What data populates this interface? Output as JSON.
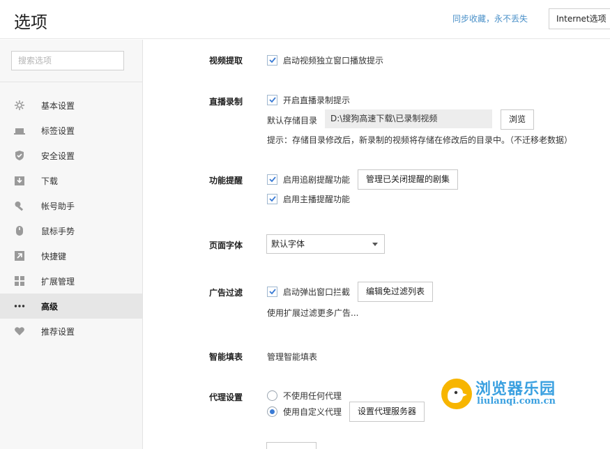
{
  "header": {
    "title": "选项",
    "sync_text": "同步收藏，永不丢失",
    "ie_button": "Internet选项"
  },
  "sidebar": {
    "search_placeholder": "搜索选项",
    "items": [
      {
        "label": "基本设置",
        "icon": "gear-icon"
      },
      {
        "label": "标签设置",
        "icon": "tab-icon"
      },
      {
        "label": "安全设置",
        "icon": "shield-icon"
      },
      {
        "label": "下载",
        "icon": "download-icon"
      },
      {
        "label": "帐号助手",
        "icon": "key-icon"
      },
      {
        "label": "鼠标手势",
        "icon": "mouse-icon"
      },
      {
        "label": "快捷键",
        "icon": "shortcut-arrow-icon"
      },
      {
        "label": "扩展管理",
        "icon": "extension-grid-icon"
      },
      {
        "label": "高级",
        "icon": "more-dots-icon",
        "active": true
      },
      {
        "label": "推荐设置",
        "icon": "recommend-heart-icon"
      }
    ]
  },
  "video": {
    "label": "视频提取",
    "option": "启动视频独立窗口播放提示",
    "checked": true
  },
  "live": {
    "label": "直播录制",
    "option": "开启直播录制提示",
    "checked": true,
    "dir_label": "默认存储目录",
    "dir_value": "D:\\搜狗高速下载\\已录制视频",
    "browse_button": "浏览",
    "hint": "提示：存储目录修改后，新录制的视频将存储在修改后的目录中。（不迁移老数据）"
  },
  "reminder": {
    "label": "功能提醒",
    "option1": "启用追剧提醒功能",
    "option2": "启用主播提醒功能",
    "manage_button": "管理已关闭提醒的剧集"
  },
  "font": {
    "label": "页面字体",
    "selected": "默认字体"
  },
  "adblock": {
    "label": "广告过滤",
    "option": "启动弹出窗口拦截",
    "edit_button": "编辑免过滤列表",
    "extension_link": "使用扩展过滤更多广告..."
  },
  "autofill": {
    "label": "智能填表",
    "link": "管理智能填表"
  },
  "proxy": {
    "label": "代理设置",
    "option_none": "不使用任何代理",
    "option_custom": "使用自定义代理",
    "selected": "custom",
    "server_button": "设置代理服务器"
  },
  "watermark": {
    "title": "浏览器乐园",
    "url": "liulanqi.com.cn"
  },
  "colors": {
    "accent": "#3a7bd5",
    "link": "#4a90c8",
    "sidebar_bg": "#f7f7f7",
    "active_bg": "#e6e6e6"
  }
}
